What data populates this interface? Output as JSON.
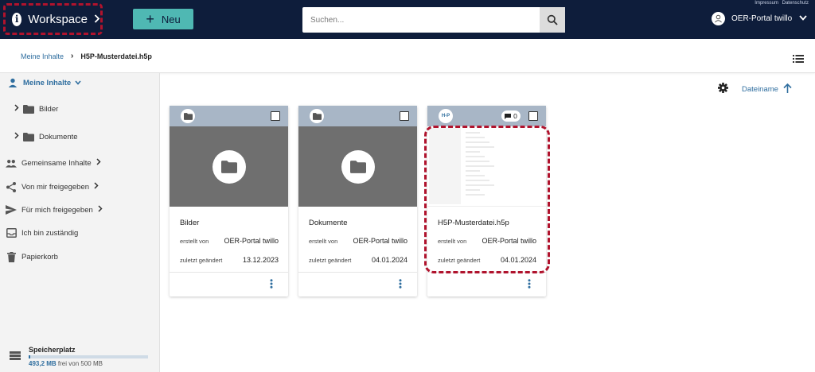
{
  "top_links": [
    "Impressum",
    "Datenschutz"
  ],
  "header": {
    "workspace_label": "Workspace",
    "new_button_label": "Neu",
    "search_placeholder": "Suchen...",
    "user_name": "OER-Portal twillo"
  },
  "breadcrumb": {
    "parent": "Meine Inhalte",
    "current": "H5P-Musterdatei.h5p"
  },
  "sidebar": {
    "items": [
      {
        "label": "Meine Inhalte"
      },
      {
        "label": "Bilder"
      },
      {
        "label": "Dokumente"
      },
      {
        "label": "Gemeinsame Inhalte"
      },
      {
        "label": "Von mir freigegeben"
      },
      {
        "label": "Für mich freigegeben"
      },
      {
        "label": "Ich bin zuständig"
      },
      {
        "label": "Papierkorb"
      }
    ],
    "storage": {
      "title": "Speicherplatz",
      "free_amount": "493,2 MB",
      "free_text": "frei von 500 MB",
      "used_fraction": 0.014
    }
  },
  "sort": {
    "label": "Dateiname"
  },
  "cards": [
    {
      "name": "Bilder",
      "created_label": "erstellt von",
      "created_by": "OER-Portal twillo",
      "modified_label": "zuletzt geändert",
      "modified": "13.12.2023"
    },
    {
      "name": "Dokumente",
      "created_label": "erstellt von",
      "created_by": "OER-Portal twillo",
      "modified_label": "zuletzt geändert",
      "modified": "04.01.2024"
    },
    {
      "name": "H5P-Musterdatei.h5p",
      "created_label": "erstellt von",
      "created_by": "OER-Portal twillo",
      "modified_label": "zuletzt geändert",
      "modified": "04.01.2024",
      "type_badge": "H-P",
      "comments": "0"
    }
  ],
  "colors": {
    "topbar": "#0e1d3b",
    "accent": "#4fb8b3",
    "link": "#2f6e9f",
    "highlight": "#b0132d"
  }
}
